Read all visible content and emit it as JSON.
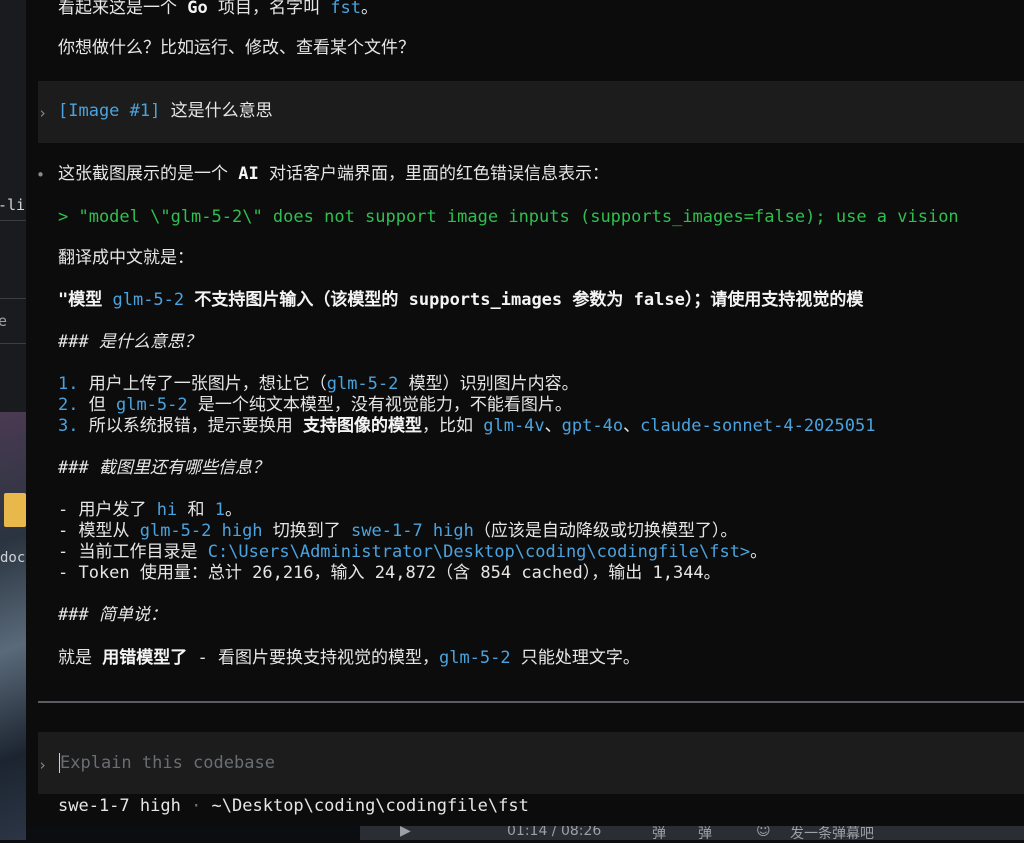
{
  "desktop": {
    "left_fragments": [
      "-li",
      "e",
      "doc"
    ],
    "taskbar": [
      "01:14 / 08:26",
      "弹",
      "弹",
      "发一条弹幕吧"
    ]
  },
  "conversation": {
    "intro_line1_pre": "看起来这是一个 ",
    "intro_line1_go": "Go",
    "intro_line1_mid": " 项目，名字叫 ",
    "intro_line1_name": "fst",
    "intro_line1_post": "。",
    "intro_line2": "你想做什么？比如运行、修改、查看某个文件？",
    "user_tag": "[Image #1]",
    "user_text": " 这是什么意思",
    "reply_line1_pre": "这张截图展示的是一个 ",
    "reply_line1_ai": "AI",
    "reply_line1_post": " 对话客户端界面，里面的红色错误信息表示：",
    "error_quote": "> \"model \\\"glm-5-2\\\" does not support image inputs (supports_images=false); use a vision",
    "translate_label": "翻译成中文就是：",
    "trans_a": "\"模型 ",
    "trans_b": "glm-5-2",
    "trans_c": " 不支持图片输入（该模型的 ",
    "trans_d": "supports_images",
    "trans_e": " 参数为 ",
    "trans_f": "false",
    "trans_g": "）；请使用支持视觉的模",
    "h1": "### 是什么意思？",
    "l1_num": "1.",
    "l1_a": " 用户上传了一张图片，想让它（",
    "l1_b": "glm-5-2",
    "l1_c": " 模型）识别图片内容。",
    "l2_num": "2.",
    "l2_a": " 但 ",
    "l2_b": "glm-5-2",
    "l2_c": " 是一个纯文本模型，没有视觉能力，不能看图片。",
    "l3_num": "3.",
    "l3_a": " 所以系统报错，提示要换用 ",
    "l3_b": "支持图像的模型",
    "l3_c": "，比如 ",
    "l3_d": "glm-4v",
    "l3_e": "、",
    "l3_f": "gpt-4o",
    "l3_g": "、",
    "l3_h": "claude-sonnet-4-2025051",
    "h2": "### 截图里还有哪些信息？",
    "b1_a": "- 用户发了 ",
    "b1_b": "hi",
    "b1_c": " 和 ",
    "b1_d": "1",
    "b1_e": "。",
    "b2_a": "- 模型从 ",
    "b2_b": "glm-5-2 high",
    "b2_c": " 切换到了 ",
    "b2_d": "swe-1-7 high",
    "b2_e": "（应该是自动降级或切换模型了）。",
    "b3_a": "- 当前工作目录是 ",
    "b3_b": "C:\\Users\\Administrator\\Desktop\\coding\\codingfile\\fst>",
    "b3_c": "。",
    "b4": "- Token 使用量：总计 26,216，输入 24,872（含 854 cached），输出 1,344。",
    "h3": "### 简单说：",
    "s_a": "就是 ",
    "s_b": "用错模型了",
    "s_c": " - 看图片要换支持视觉的模型，",
    "s_d": "glm-5-2",
    "s_e": " 只能处理文字。"
  },
  "input": {
    "placeholder": "Explain this codebase"
  },
  "status": {
    "model": "swe-1-7 high",
    "separator": " · ",
    "path": "~\\Desktop\\coding\\codingfile\\fst"
  }
}
